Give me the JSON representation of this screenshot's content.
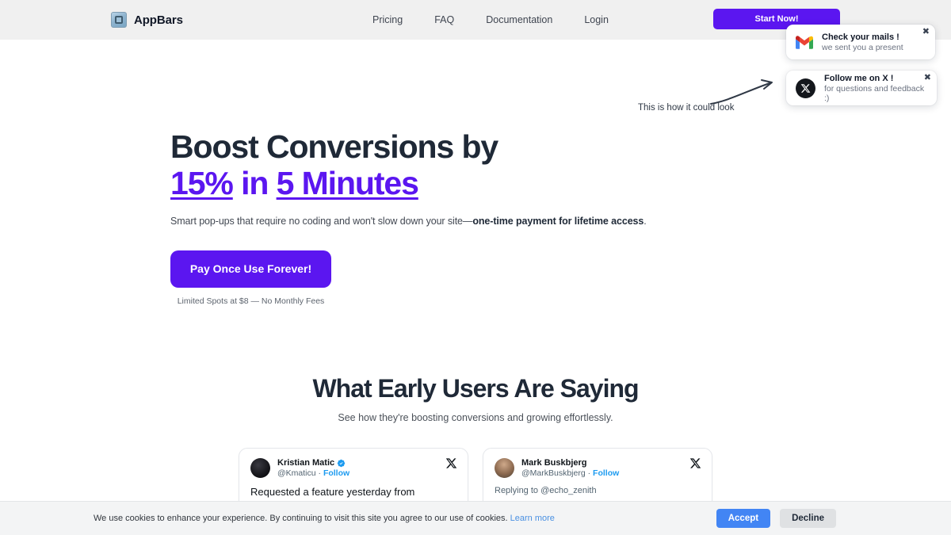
{
  "header": {
    "brand": {
      "name": "AppBars",
      "logo_icon": "app-square-icon"
    },
    "nav": [
      {
        "label": "Pricing"
      },
      {
        "label": "FAQ"
      },
      {
        "label": "Documentation"
      },
      {
        "label": "Login"
      }
    ],
    "cta": {
      "label": "Start Now!",
      "color": "#5b16f0"
    }
  },
  "popups": [
    {
      "icon": "gmail-icon",
      "title": "Check your mails !",
      "subtitle": "we sent you a present",
      "close_label": "✖"
    },
    {
      "icon": "x-logo-icon",
      "title": "Follow me on X !",
      "subtitle": "for questions and feedback :)",
      "close_label": "✖"
    }
  ],
  "annotation": {
    "text": "This is how it could look",
    "arrow_icon": "curved-arrow-icon"
  },
  "hero": {
    "headline_line1": "Boost Conversions by",
    "headline_accent_1": "15%",
    "headline_mid": "in",
    "headline_accent_2": "5 Minutes",
    "subtitle_plain_1": "Smart pop-ups that require no coding and won't slow down your site—",
    "subtitle_bold": "one-time payment for lifetime access",
    "subtitle_plain_2": ".",
    "cta_label": "Pay Once Use Forever!",
    "note": "Limited Spots at $8 — No Monthly Fees",
    "accent_color": "#5b16f0"
  },
  "testimonials": {
    "heading": "What Early Users Are Saying",
    "subheading": "See how they're boosting conversions and growing effortlessly.",
    "cards": [
      {
        "avatar": "avatar-kristian",
        "name": "Kristian Matic",
        "verified": true,
        "handle": "@Kmaticu",
        "separator": "·",
        "follow_label": "Follow",
        "platform_icon": "x-logo-icon",
        "body": "Requested a feature yesterday from"
      },
      {
        "avatar": "avatar-mark",
        "name": "Mark Buskbjerg",
        "verified": false,
        "handle": "@MarkBuskbjerg",
        "separator": "·",
        "follow_label": "Follow",
        "platform_icon": "x-logo-icon",
        "body": "Replying to @echo_zenith"
      }
    ]
  },
  "cookie": {
    "text": "We use cookies to enhance your experience. By continuing to visit this site you agree to our use of cookies.",
    "link_label": "Learn more",
    "accept_label": "Accept",
    "decline_label": "Decline",
    "accept_color": "#4285f4"
  }
}
